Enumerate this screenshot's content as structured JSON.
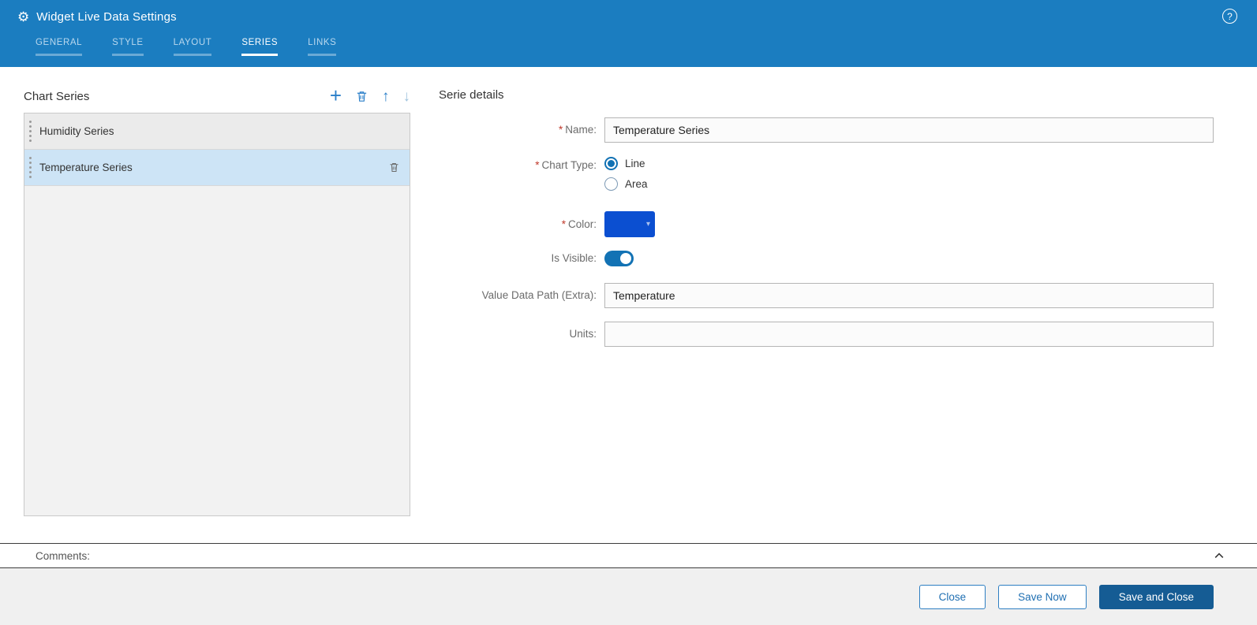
{
  "header": {
    "title": "Widget Live Data Settings",
    "help_label": "?",
    "tabs": [
      {
        "label": "GENERAL",
        "active": false
      },
      {
        "label": "STYLE",
        "active": false
      },
      {
        "label": "LAYOUT",
        "active": false
      },
      {
        "label": "SERIES",
        "active": true
      },
      {
        "label": "LINKS",
        "active": false
      }
    ]
  },
  "series_panel": {
    "title": "Chart Series",
    "items": [
      {
        "label": "Humidity Series",
        "selected": false
      },
      {
        "label": "Temperature Series",
        "selected": true
      }
    ]
  },
  "details": {
    "title": "Serie details",
    "required_marker": "*",
    "name": {
      "label": "Name:",
      "required": true,
      "value": "Temperature Series"
    },
    "chart_type": {
      "label": "Chart Type:",
      "required": true,
      "options": [
        {
          "label": "Line",
          "selected": true
        },
        {
          "label": "Area",
          "selected": false
        }
      ]
    },
    "color": {
      "label": "Color:",
      "required": true,
      "value": "#0b4fd1"
    },
    "is_visible": {
      "label": "Is Visible:",
      "value": true
    },
    "value_data_path": {
      "label": "Value Data Path (Extra):",
      "value": "Temperature"
    },
    "units": {
      "label": "Units:",
      "value": ""
    }
  },
  "comments": {
    "label": "Comments:"
  },
  "footer": {
    "close_label": "Close",
    "save_now_label": "Save Now",
    "save_and_close_label": "Save and Close"
  },
  "colors": {
    "header_blue": "#1b7dc0",
    "accent_blue": "#1272b4",
    "selected_item_bg": "#cde4f6",
    "swatch_blue": "#0b4fd1",
    "primary_button": "#155c94"
  }
}
